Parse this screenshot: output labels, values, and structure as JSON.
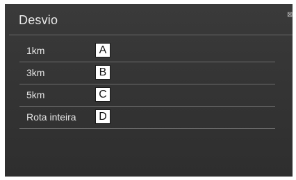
{
  "screen": {
    "title": "Desvio",
    "corner_icon": "small-settings-icon"
  },
  "options": [
    {
      "label": "1km",
      "callout": "A"
    },
    {
      "label": "3km",
      "callout": "B"
    },
    {
      "label": "5km",
      "callout": "C"
    },
    {
      "label": "Rota inteira",
      "callout": "D"
    }
  ],
  "colors": {
    "background": "#333333",
    "text": "#e6e6e6",
    "divider": "#6e6e6e",
    "callout_bg": "#ffffff",
    "callout_text": "#111111"
  }
}
